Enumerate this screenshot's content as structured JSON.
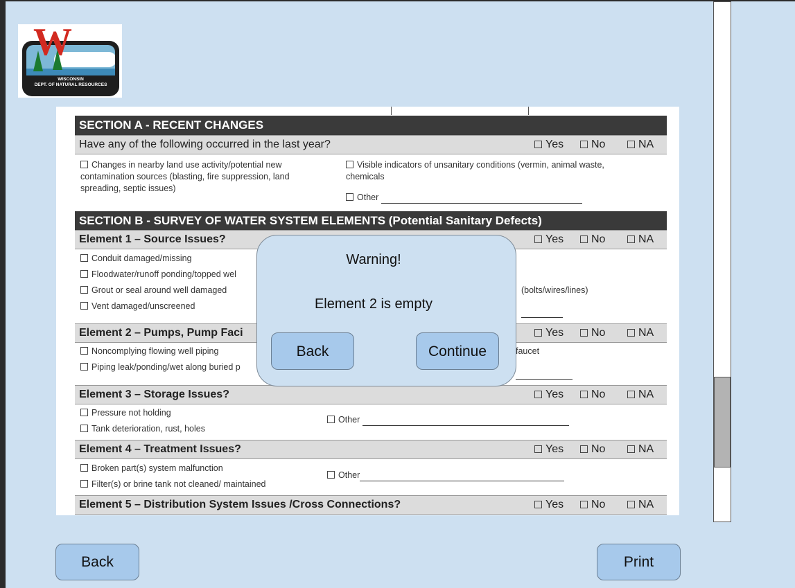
{
  "logo": {
    "caption_line1": "WISCONSIN",
    "caption_line2": "DEPT. OF NATURAL RESOURCES"
  },
  "form": {
    "section_a": {
      "title": "SECTION A  -  RECENT CHANGES",
      "question": "Have any of the following occurred in the last year?",
      "yes": "Yes",
      "no": "No",
      "na": "NA",
      "opt_changes_1": "Changes in nearby land use activity/potential new",
      "opt_changes_2": "contamination sources (blasting, fire suppression, land",
      "opt_changes_3": "spreading, septic issues)",
      "opt_visible_1": "Visible indicators of unsanitary conditions (vermin, animal waste,",
      "opt_visible_2": "chemicals",
      "opt_other": "Other"
    },
    "section_b": {
      "title": "SECTION B  -  SURVEY OF WATER SYSTEM ELEMENTS (Potential Sanitary Defects)"
    },
    "element1": {
      "title": "Element 1 – Source Issues?",
      "yes": "Yes",
      "no": "No",
      "na": "NA",
      "opt1": "Conduit damaged/missing",
      "opt2": "Floodwater/runoff ponding/topped wel",
      "opt3": "Grout or seal around well damaged",
      "opt4": "Vent damaged/unscreened",
      "right_text": "(bolts/wires/lines)"
    },
    "element2": {
      "title": "Element 2 – Pumps, Pump Faci",
      "yes": "Yes",
      "no": "No",
      "na": "NA",
      "opt1": "Noncomplying flowing well piping",
      "opt2": "Piping leak/ponding/wet along buried p",
      "right_text": "faucet"
    },
    "element3": {
      "title": "Element 3 – Storage Issues?",
      "yes": "Yes",
      "no": "No",
      "na": "NA",
      "opt1": "Pressure not holding",
      "opt2": "Tank deterioration, rust, holes",
      "opt_other": "Other"
    },
    "element4": {
      "title": "Element 4 – Treatment Issues?",
      "yes": "Yes",
      "no": "No",
      "na": "NA",
      "opt1": "Broken part(s) system malfunction",
      "opt2": "Filter(s) or brine tank not cleaned/ maintained",
      "opt_other": "Other"
    },
    "element5": {
      "title": "Element 5 – Distribution System Issues /Cross Connections?",
      "yes": "Yes",
      "no": "No",
      "na": "NA"
    }
  },
  "dialog": {
    "title": "Warning!",
    "message": "Element 2 is empty",
    "back_label": "Back",
    "continue_label": "Continue"
  },
  "footer": {
    "back_label": "Back",
    "print_label": "Print"
  },
  "colors": {
    "background": "#cde0f1",
    "button": "#a7c9eb",
    "section_header": "#3a3a3a",
    "question_row": "#dcdcdc"
  }
}
